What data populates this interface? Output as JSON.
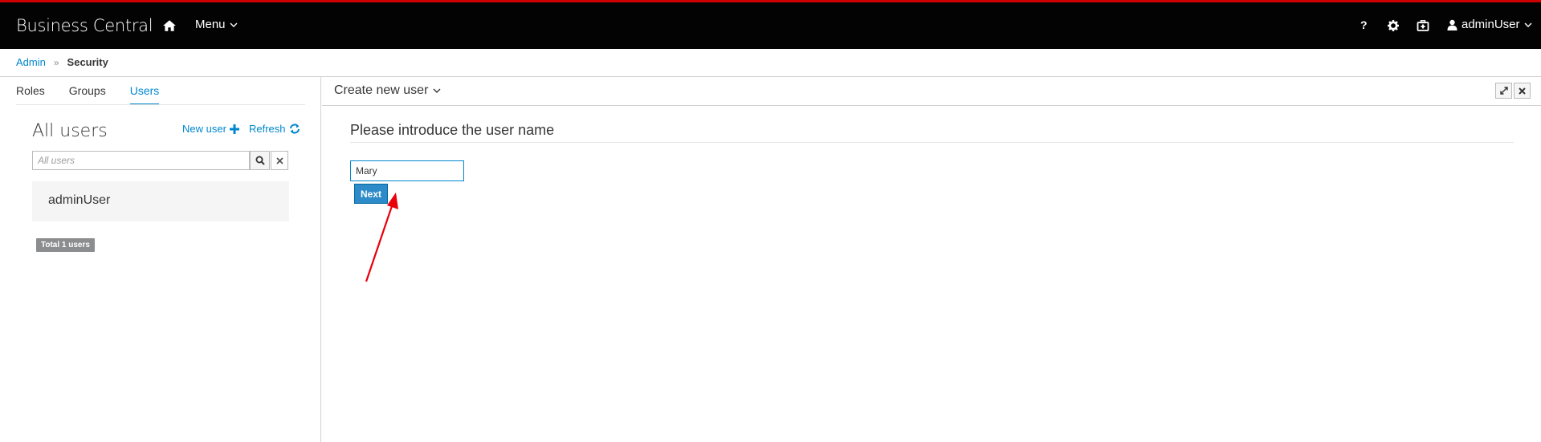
{
  "topbar": {
    "brand": "Business Central",
    "menu_label": "Menu",
    "help_label": "?",
    "username": "adminUser"
  },
  "breadcrumb": {
    "items": [
      "Admin",
      "Security"
    ],
    "separator": "»"
  },
  "left": {
    "tabs": [
      {
        "label": "Roles",
        "active": false
      },
      {
        "label": "Groups",
        "active": false
      },
      {
        "label": "Users",
        "active": true
      }
    ],
    "title": "All users",
    "new_user_label": "New user",
    "refresh_label": "Refresh",
    "search_placeholder": "All users",
    "search_value": "",
    "users": [
      "adminUser"
    ],
    "total_badge": "Total 1 users"
  },
  "right": {
    "panel_title": "Create new user",
    "heading": "Please introduce the user name",
    "username_value": "Mary",
    "next_label": "Next"
  },
  "colors": {
    "accent": "#0088ce",
    "topbar_bg": "#030303",
    "topbar_border": "#cc0000",
    "button_bg": "#2e8bc9",
    "annotation_arrow": "#e8000b"
  },
  "icons": [
    "home-icon",
    "chevron-down-icon",
    "gear-icon",
    "briefcase-icon",
    "user-icon",
    "plus-icon",
    "refresh-icon",
    "search-icon",
    "close-icon",
    "expand-icon"
  ]
}
